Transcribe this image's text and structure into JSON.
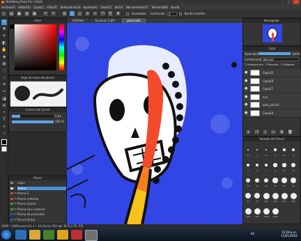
{
  "window": {
    "title": "MediBang Paint Pro (32bit)"
  },
  "menu": [
    "Archivo(F)",
    "Editar(E)",
    "Capa(L)",
    "Filtro(F)",
    "Seleccionar(S)",
    "Ajustes(A)",
    "Color(C)",
    "Ver(V)",
    "Herramientas(T)",
    "Ventana(W)",
    "Ayuda"
  ],
  "toolbar": {
    "suavizado_label": "Suavizado",
    "correccion_label": "Corrección",
    "correccion_value": "0",
    "bordes_label": "Bordes fuertes"
  },
  "panels": {
    "color_title": "Color",
    "brush_settings_title": "Hoja de trazo del pincel",
    "brush_control_title": "Control del pincel",
    "brush_size": "5 px",
    "brush_opacity": "100 %",
    "brush_list_title": "Pincel",
    "navigator_title": "Navegador",
    "layer_title": "Capa",
    "opacity_label": "Opacidad",
    "opacity_value": "100%",
    "blend_label": "Combinación",
    "blend_value": "Normal",
    "protect_alpha": "Proteger alfa",
    "recorte": "Recortar",
    "bloquear": "Bloquear",
    "brush_size_panel_title": "Tamaño del Pincel"
  },
  "canvas_tabs": [
    "Untitled",
    "Escaneo 1.JPG",
    "pixel.mbk"
  ],
  "brushes": [
    {
      "size": "",
      "name": "Lápiz",
      "color": "#888888"
    },
    {
      "size": "8",
      "name": "Pluma",
      "color": "#e0e0e0",
      "selected": true
    },
    {
      "size": "15",
      "name": "Pluma G",
      "color": "#d04040"
    },
    {
      "size": "10",
      "name": "Pluma redonda",
      "color": "#d04040"
    },
    {
      "size": "40",
      "name": "Pluma (lenta)",
      "color": "#30a030"
    },
    {
      "size": "30",
      "name": "Pluma con contorno",
      "color": "#30a030"
    },
    {
      "size": "10",
      "name": "Pluma de punteado",
      "color": "#3050c0"
    },
    {
      "size": "30",
      "name": "Pincel (tinta)",
      "color": "#3050c0"
    }
  ],
  "layers": [
    "Capa31",
    "Capa29",
    "Capa27",
    "cyn",
    "puls_pinch2",
    "Capa24"
  ],
  "brush_size_labels": [
    "0.7",
    "1",
    "1.5",
    "2",
    "2.5",
    "3",
    "4",
    "5",
    "7",
    "8",
    "10",
    "12",
    "15",
    "17",
    "20",
    "25",
    "30",
    "40",
    "50",
    "70",
    "100",
    "150",
    "200",
    "300",
    "500",
    "700",
    "1000",
    "1500"
  ],
  "status": {
    "text": "2000 * 1900 pixel (12.1 * 10.03cm) 350 dpi 36 % (-55, 53)"
  },
  "taskbar": {
    "lang": "ES",
    "time": "12:29 p.m.",
    "date": "11/01/2016"
  },
  "colors": {
    "canvas_blue": "#3246e6",
    "selection_accent": "#4a90d9"
  }
}
